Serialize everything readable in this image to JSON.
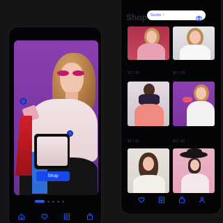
{
  "left_screen": {
    "hero_shop_button": "Shop",
    "carousel": {
      "total_slides": 6,
      "active_slide": 1
    },
    "nav": [
      {
        "icon": "home-icon"
      },
      {
        "icon": "heart-icon"
      },
      {
        "icon": "receipt-icon"
      },
      {
        "icon": "bag-icon"
      }
    ]
  },
  "right_screen": {
    "title": "Shop",
    "search": {
      "chip_label": "Socks",
      "chip_remove": "×"
    },
    "prices": [
      "$17.00",
      "$17.00",
      "$17.00",
      "$17.00"
    ],
    "nav": [
      {
        "icon": "heart-icon"
      },
      {
        "icon": "receipt-icon"
      },
      {
        "icon": "bag-icon"
      },
      {
        "icon": "profile-icon"
      }
    ]
  },
  "colors": {
    "background": "#151517",
    "phone": "#050507",
    "accent": "#1648ea",
    "hero_bg": "#8a3fae"
  }
}
